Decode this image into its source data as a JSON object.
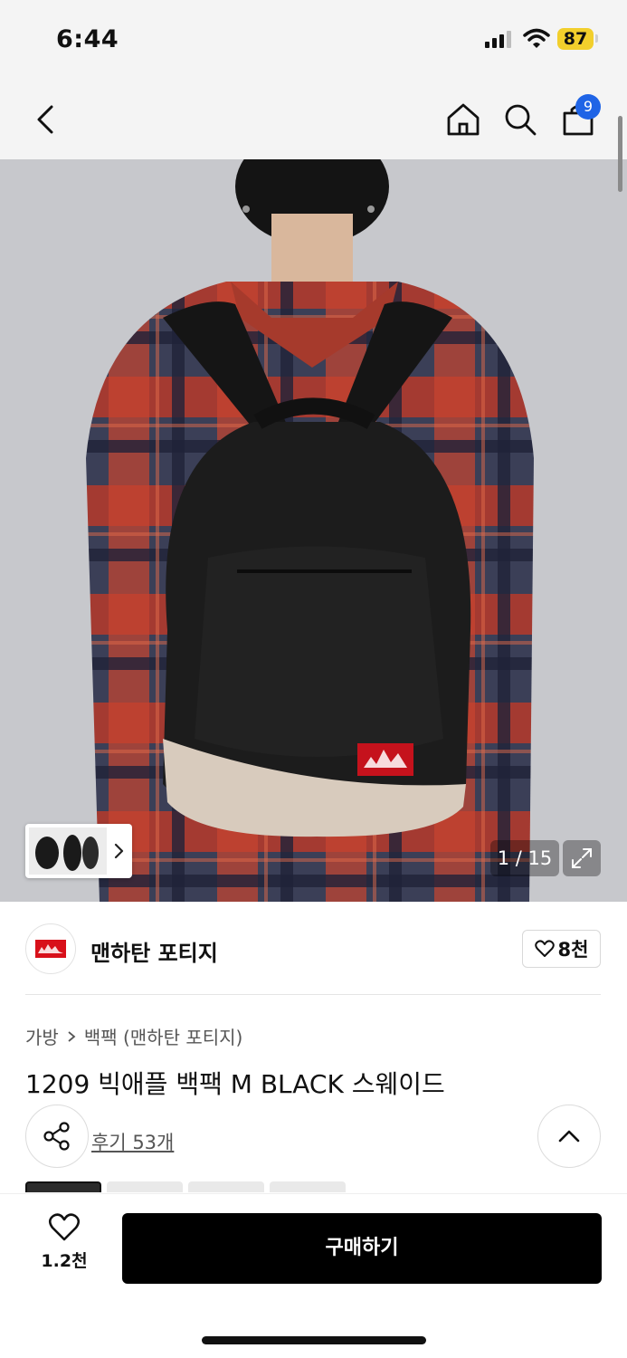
{
  "status_bar": {
    "time": "6:44",
    "battery": "87",
    "icons": [
      "signal-icon",
      "wifi-icon",
      "battery-icon"
    ]
  },
  "top_nav": {
    "icons": [
      "back-icon",
      "home-icon",
      "search-icon",
      "cart-icon"
    ],
    "cart_badge": "9"
  },
  "gallery": {
    "pager": "1 / 15",
    "icons": [
      "chevron-right-icon",
      "expand-icon"
    ]
  },
  "brand": {
    "name": "맨하탄 포티지",
    "likes": "8천",
    "logo_icon": "manhattan-portage-logo",
    "logo_color": "#d8101a"
  },
  "product": {
    "breadcrumb_category": "가방",
    "breadcrumb_sub": "백팩 (맨하탄 포티지)",
    "title": "1209 빅애플 백팩 M BLACK 스웨이드",
    "reviews": "후기 53개"
  },
  "bottom_bar": {
    "wish_count": "1.2천",
    "buy_label": "구매하기"
  },
  "colors": {
    "accent_badge": "#1f64e6",
    "battery": "#f2cf2c",
    "primary_button": "#000000"
  }
}
